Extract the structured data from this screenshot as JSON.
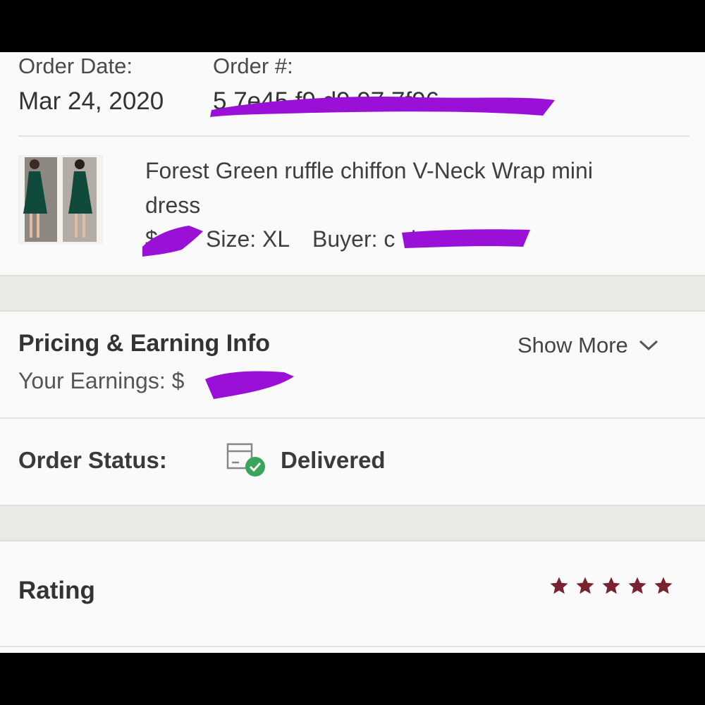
{
  "order_header": {
    "date_label": "Order Date:",
    "date_value": "Mar 24, 2020",
    "number_label": "Order #:",
    "number_value_partial": "5  7e45  f9  d9   97  7f96 "
  },
  "item": {
    "title_line1": "Forest Green ruffle chiffon V-Neck Wrap mini",
    "title_line2": "dress",
    "price_partial": "$",
    "size_text": "Size: XL",
    "buyer_label": "Buyer: c",
    "buyer_partial": "h      r"
  },
  "pricing": {
    "title": "Pricing & Earning Info",
    "show_more": "Show More",
    "earnings_label": "Your Earnings: $"
  },
  "status": {
    "label": "Order Status:",
    "value": "Delivered"
  },
  "rating": {
    "label": "Rating",
    "stars": 5,
    "max_stars": 5
  },
  "colors": {
    "star": "#7a2330",
    "check": "#3aa55a",
    "redaction": "#9b10d6",
    "gap_band": "#ebe9e6",
    "text": "#3a3a3a"
  }
}
